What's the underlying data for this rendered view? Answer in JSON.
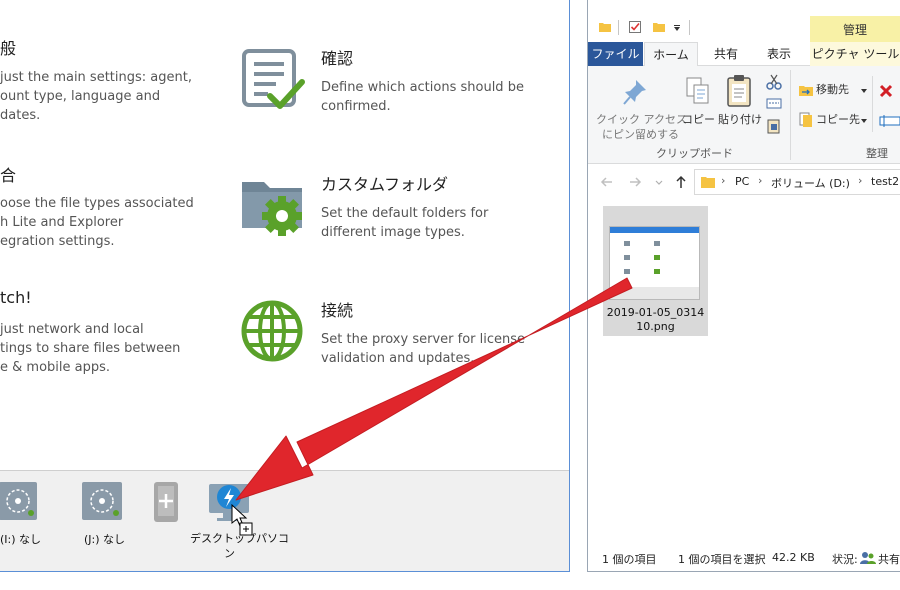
{
  "settings": {
    "categories": [
      {
        "id": "general",
        "title": "般",
        "desc": [
          "just the main settings: agent,",
          "ount type, language and",
          "dates."
        ]
      },
      {
        "id": "confirm",
        "title": "確認",
        "desc": [
          "Define which actions should be",
          "confirmed."
        ]
      },
      {
        "id": "association",
        "title": "合",
        "desc": [
          "oose the file types associated",
          "h Lite and Explorer",
          "egration settings."
        ]
      },
      {
        "id": "custom-folder",
        "title": "カスタムフォルダ",
        "desc": [
          "Set the default folders for",
          "different image types."
        ]
      },
      {
        "id": "watch",
        "title": "tch!",
        "desc": [
          "just network and local",
          "tings to share files between",
          "e & mobile apps."
        ]
      },
      {
        "id": "connection",
        "title": "接続",
        "desc": [
          "Set the proxy server for license",
          "validation and updates."
        ]
      }
    ],
    "dock": {
      "drive_i": "(I:) なし",
      "drive_j": "(J:) なし",
      "desktop_line1": "デスクトップパソコ",
      "desktop_line2": "ン"
    }
  },
  "explorer": {
    "context_tab": "管理",
    "tabs": {
      "file": "ファイル",
      "home": "ホーム",
      "share": "共有",
      "view": "表示",
      "picture_tools": "ピクチャ ツール"
    },
    "ribbon": {
      "quick_access_line1": "クイック アクセス",
      "quick_access_line2": "にピン留めする",
      "copy": "コピー",
      "paste": "貼り付け",
      "group_clipboard": "クリップボード",
      "move_to": "移動先",
      "copy_to": "コピー先",
      "group_organize": "整理"
    },
    "breadcrumb": {
      "pc": "PC",
      "volume": "ボリューム (D:)",
      "folder": "test2"
    },
    "file": {
      "name_line1": "2019-01-05_0314",
      "name_line2": "10.png"
    },
    "status": {
      "count": "1 個の項目",
      "selected": "1 個の項目を選択",
      "size": "42.2 KB",
      "state_label": "状況:",
      "state_value": "共有"
    }
  },
  "colors": {
    "accent_blue": "#1f6fbf",
    "file_tab": "#2b579a",
    "context_yellow": "#f8f1a6",
    "check_green": "#5aa12a",
    "arrow_red": "#e0262c",
    "selection": "#cce8ff"
  }
}
